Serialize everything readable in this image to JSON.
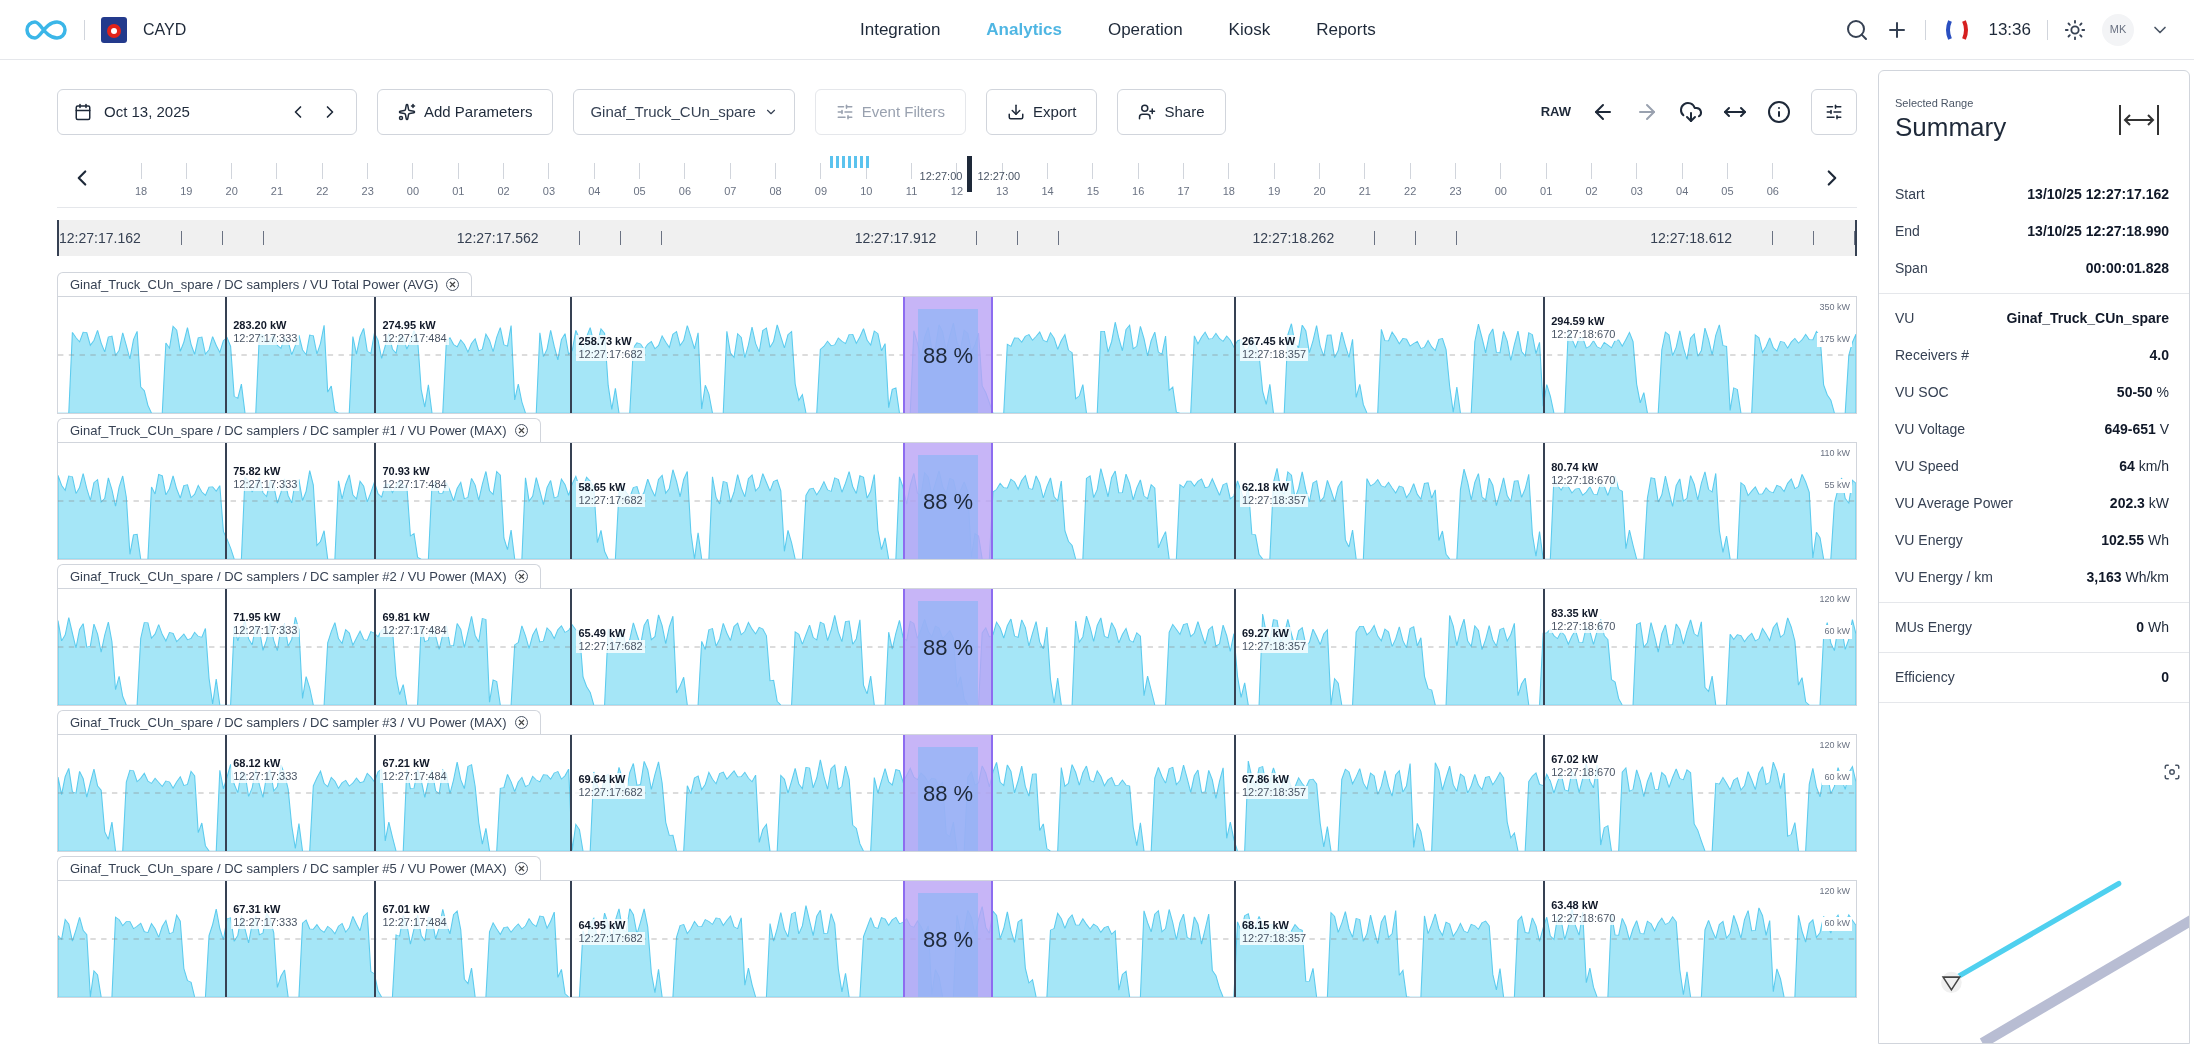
{
  "header": {
    "brand": "CAYD",
    "nav": [
      {
        "label": "Integration",
        "selected": false
      },
      {
        "label": "Analytics",
        "selected": true
      },
      {
        "label": "Operation",
        "selected": false
      },
      {
        "label": "Kiosk",
        "selected": false
      },
      {
        "label": "Reports",
        "selected": false
      }
    ],
    "time": "13:36",
    "avatar": "MK"
  },
  "toolbar": {
    "date": "Oct 13, 2025",
    "add_parameters": "Add Parameters",
    "vehicle": "Ginaf_Truck_CUn_spare",
    "event_filters": {
      "label": "Event Filters",
      "disabled": true
    },
    "export": "Export",
    "share": "Share",
    "raw": "RAW"
  },
  "timeline": {
    "labels": [
      "18",
      "19",
      "20",
      "21",
      "22",
      "23",
      "00",
      "01",
      "02",
      "03",
      "04",
      "05",
      "06",
      "07",
      "08",
      "09",
      "10",
      "11",
      "12",
      "13",
      "14",
      "15",
      "16",
      "17",
      "18",
      "19",
      "20",
      "21",
      "22",
      "23",
      "00",
      "01",
      "02",
      "03",
      "04",
      "05",
      "06"
    ],
    "cursor_labels": [
      "12:27:00",
      "12:27:00"
    ]
  },
  "ruler": [
    "12:27:17.162",
    "12:27:17.562",
    "12:27:17.912",
    "12:27:18.262",
    "12:27:18.612"
  ],
  "charts": [
    {
      "title": "Ginaf_Truck_CUn_spare / DC samplers / VU Total Power (AVG)",
      "ytick_labels": [
        "350 kW",
        "175 kW"
      ],
      "selection_label": "88 %",
      "markers": [
        {
          "value": "283.20 kW",
          "time": "12:27:17:333"
        },
        {
          "value": "274.95 kW",
          "time": "12:27:17:484"
        },
        {
          "value": "258.73 kW",
          "time": "12:27:17:682"
        },
        {
          "value": "267.45 kW",
          "time": "12:27:18:357"
        },
        {
          "value": "294.59 kW",
          "time": "12:27:18:670"
        }
      ]
    },
    {
      "title": "Ginaf_Truck_CUn_spare / DC samplers / DC sampler #1 / VU Power (MAX)",
      "ytick_labels": [
        "110 kW",
        "55 kW"
      ],
      "selection_label": "88 %",
      "markers": [
        {
          "value": "75.82 kW",
          "time": "12:27:17:333"
        },
        {
          "value": "70.93 kW",
          "time": "12:27:17:484"
        },
        {
          "value": "58.65 kW",
          "time": "12:27:17:682"
        },
        {
          "value": "62.18 kW",
          "time": "12:27:18:357"
        },
        {
          "value": "80.74 kW",
          "time": "12:27:18:670"
        }
      ]
    },
    {
      "title": "Ginaf_Truck_CUn_spare / DC samplers / DC sampler #2 / VU Power (MAX)",
      "ytick_labels": [
        "120 kW",
        "60 kW"
      ],
      "selection_label": "88 %",
      "markers": [
        {
          "value": "71.95 kW",
          "time": "12:27:17:333"
        },
        {
          "value": "69.81 kW",
          "time": "12:27:17:484"
        },
        {
          "value": "65.49 kW",
          "time": "12:27:17:682"
        },
        {
          "value": "69.27 kW",
          "time": "12:27:18:357"
        },
        {
          "value": "83.35 kW",
          "time": "12:27:18:670"
        }
      ]
    },
    {
      "title": "Ginaf_Truck_CUn_spare / DC samplers / DC sampler #3 / VU Power (MAX)",
      "ytick_labels": [
        "120 kW",
        "60 kW"
      ],
      "selection_label": "88 %",
      "markers": [
        {
          "value": "68.12 kW",
          "time": "12:27:17:333"
        },
        {
          "value": "67.21 kW",
          "time": "12:27:17:484"
        },
        {
          "value": "69.64 kW",
          "time": "12:27:17:682"
        },
        {
          "value": "67.86 kW",
          "time": "12:27:18:357"
        },
        {
          "value": "67.02 kW",
          "time": "12:27:18:670"
        }
      ]
    },
    {
      "title": "Ginaf_Truck_CUn_spare / DC samplers / DC sampler #5 / VU Power (MAX)",
      "ytick_labels": [
        "120 kW",
        "60 kW"
      ],
      "selection_label": "88 %",
      "markers": [
        {
          "value": "67.31 kW",
          "time": "12:27:17:333"
        },
        {
          "value": "67.01 kW",
          "time": "12:27:17:484"
        },
        {
          "value": "64.95 kW",
          "time": "12:27:17:682"
        },
        {
          "value": "68.15 kW",
          "time": "12:27:18:357"
        },
        {
          "value": "63.48 kW",
          "time": "12:27:18:670"
        }
      ]
    }
  ],
  "summary": {
    "caption": "Selected Range",
    "title": "Summary",
    "groups": [
      [
        {
          "label": "Start",
          "value": "13/10/25 12:27:17.162"
        },
        {
          "label": "End",
          "value": "13/10/25 12:27:18.990"
        },
        {
          "label": "Span",
          "value": "00:00:01.828"
        }
      ],
      [
        {
          "label": "VU",
          "value": "Ginaf_Truck_CUn_spare"
        },
        {
          "label": "Receivers #",
          "value": "4.0"
        },
        {
          "label": "VU SOC",
          "value": "50-50",
          "unit": "%"
        },
        {
          "label": "VU Voltage",
          "value": "649-651",
          "unit": "V"
        },
        {
          "label": "VU Speed",
          "value": "64",
          "unit": "km/h"
        },
        {
          "label": "VU Average Power",
          "value": "202.3",
          "unit": "kW"
        },
        {
          "label": "VU Energy",
          "value": "102.55",
          "unit": "Wh"
        },
        {
          "label": "VU Energy / km",
          "value": "3,163",
          "unit": "Wh/km"
        }
      ],
      [
        {
          "label": "MUs Energy",
          "value": "0",
          "unit": "Wh"
        }
      ],
      [
        {
          "label": "Efficiency",
          "value": "0"
        }
      ]
    ]
  }
}
